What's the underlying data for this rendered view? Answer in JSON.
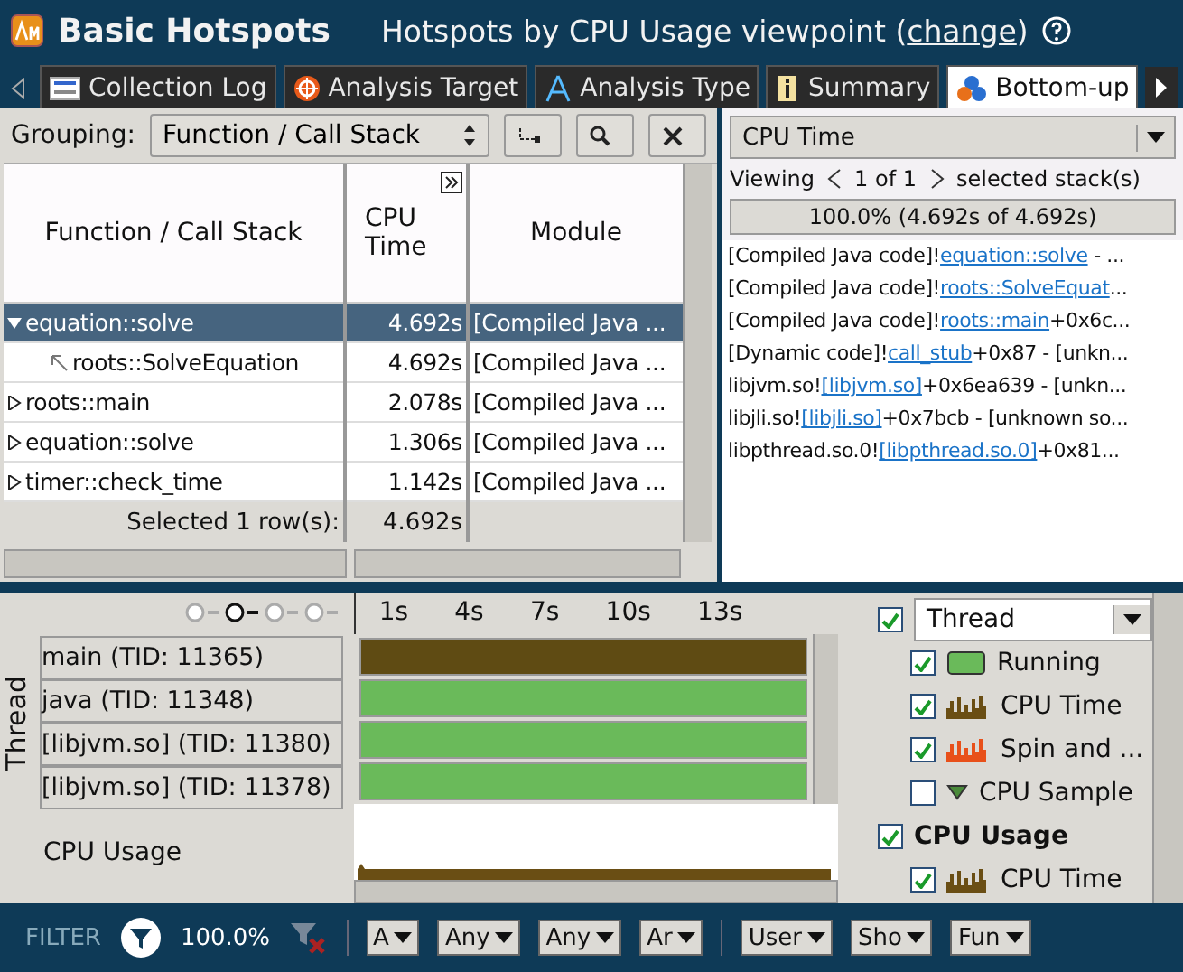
{
  "header": {
    "title": "Basic Hotspots",
    "viewpoint": "Hotspots by CPU Usage viewpoint (",
    "link": "change",
    "viewpoint_end": ")"
  },
  "tabs": [
    {
      "label": "Collection Log",
      "selected": false,
      "kind": "log"
    },
    {
      "label": "Analysis Target",
      "selected": false,
      "kind": "target"
    },
    {
      "label": "Analysis Type",
      "selected": false,
      "kind": "type"
    },
    {
      "label": "Summary",
      "selected": false,
      "kind": "summary"
    },
    {
      "label": "Bottom-up",
      "selected": true,
      "kind": "bottomup"
    }
  ],
  "grouping": {
    "label": "Grouping:",
    "value": "Function / Call Stack"
  },
  "table": {
    "columns": [
      "Function / Call Stack",
      "CPU Time",
      "Module"
    ],
    "rows": [
      {
        "kind": "node",
        "function": "equation::solve",
        "cpu_time": "4.692s",
        "module": "[Compiled Java ...",
        "expanded": true,
        "selected": true
      },
      {
        "kind": "caller",
        "function": "roots::SolveEquation",
        "cpu_time": "4.692s",
        "module": "[Compiled Java ...",
        "selected": false
      },
      {
        "kind": "node",
        "function": "roots::main",
        "cpu_time": "2.078s",
        "module": "[Compiled Java ...",
        "expanded": false,
        "selected": false
      },
      {
        "kind": "node",
        "function": "equation::solve",
        "cpu_time": "1.306s",
        "module": "[Compiled Java ...",
        "expanded": false,
        "selected": false
      },
      {
        "kind": "node",
        "function": "timer::check_time",
        "cpu_time": "1.142s",
        "module": "[Compiled Java ...",
        "expanded": false,
        "selected": false
      }
    ],
    "footer": {
      "label": "Selected 1 row(s):",
      "cpu_time": "4.692s"
    }
  },
  "stack_pane": {
    "metric": "CPU Time",
    "viewing": "Viewing",
    "position": "1 of 1",
    "suffix": "selected stack(s)",
    "share": "100.0% (4.692s of 4.692s)",
    "frames": [
      {
        "prefix": "[Compiled Java code]!",
        "link": "equation::solve",
        "suffix": " - ..."
      },
      {
        "prefix": "[Compiled Java code]!",
        "link": "roots::SolveEquat",
        "suffix": "..."
      },
      {
        "prefix": "[Compiled Java code]!",
        "link": "roots::main",
        "suffix": "+0x6c..."
      },
      {
        "prefix": "[Dynamic code]!",
        "link": "call_stub",
        "suffix": "+0x87 - [unkn..."
      },
      {
        "prefix": "libjvm.so!",
        "link": "[libjvm.so]",
        "suffix": "+0x6ea639 - [unkn..."
      },
      {
        "prefix": "libjli.so!",
        "link": "[libjli.so]",
        "suffix": "+0x7bcb - [unknown so..."
      },
      {
        "prefix": "libpthread.so.0!",
        "link": "[libpthread.so.0]",
        "suffix": "+0x81..."
      }
    ]
  },
  "timeline": {
    "axis_label": "Thread",
    "ticks": [
      "1s",
      "4s",
      "7s",
      "10s",
      "13s"
    ],
    "threads": [
      {
        "name": "main (TID: 11365)",
        "color": "#5f4b13"
      },
      {
        "name": "java (TID: 11348)",
        "color": "#6aba5a"
      },
      {
        "name": "[libjvm.so] (TID: 11380)",
        "color": "#6aba5a"
      },
      {
        "name": "[libjvm.so] (TID: 11378)",
        "color": "#6aba5a"
      }
    ],
    "cpu_usage_label": "CPU Usage"
  },
  "legend": {
    "thread_checked": true,
    "thread_select": "Thread",
    "thread_items": [
      {
        "kind": "swatch",
        "label": "Running",
        "checked": true
      },
      {
        "kind": "cpu",
        "label": "CPU Time",
        "checked": true
      },
      {
        "kind": "spin",
        "label": "Spin and ...",
        "checked": true
      },
      {
        "kind": "marker",
        "label": "CPU Sample",
        "checked": false
      }
    ],
    "cpu_usage_label": "CPU Usage",
    "cpu_usage_checked": true,
    "cpu_usage_items": [
      {
        "kind": "cpu",
        "label": "CPU Time",
        "checked": true
      }
    ]
  },
  "filter": {
    "label": "FILTER",
    "percent": "100.0%",
    "groups": [
      [
        "A",
        "Any",
        "Any",
        "Ar"
      ],
      [
        "User",
        "Sho",
        "Fun"
      ]
    ]
  }
}
